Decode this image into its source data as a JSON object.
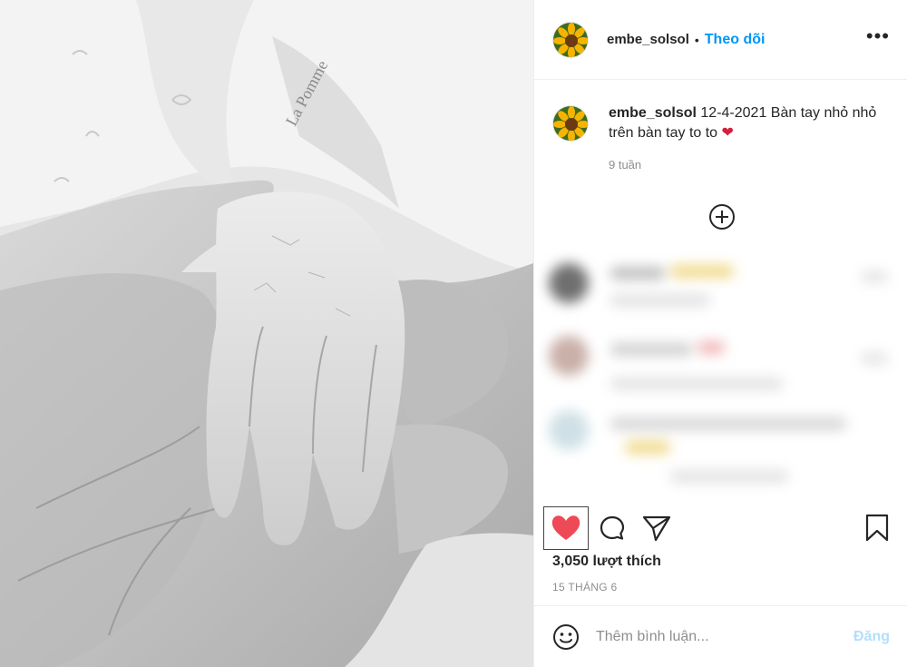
{
  "post": {
    "username": "embe_solsol",
    "separator": "•",
    "follow_label": "Theo dõi",
    "more_label": "•••",
    "caption_user": "embe_solsol",
    "caption_text": "12-4-2021 Bàn tay nhỏ nhỏ trên bàn tay to to",
    "caption_emoji": "❤",
    "time_ago": "9 tuần",
    "likes": "3,050 lượt thích",
    "date": "15 THÁNG 6",
    "photo_text": "La Pomme"
  },
  "comment_bar": {
    "placeholder": "Thêm bình luận...",
    "post_label": "Đăng"
  },
  "icons": {
    "avatar": "sunflower-avatar",
    "more": "ellipsis-icon",
    "load_more": "plus-circle-icon",
    "like": "heart-filled-icon",
    "comment": "comment-bubble-icon",
    "share": "paper-plane-icon",
    "save": "bookmark-icon",
    "emoji": "smiley-icon"
  },
  "colors": {
    "accent": "#0095f6",
    "liked": "#ed4956",
    "muted": "#8e8e8e",
    "post_disabled": "#b2dffc"
  }
}
